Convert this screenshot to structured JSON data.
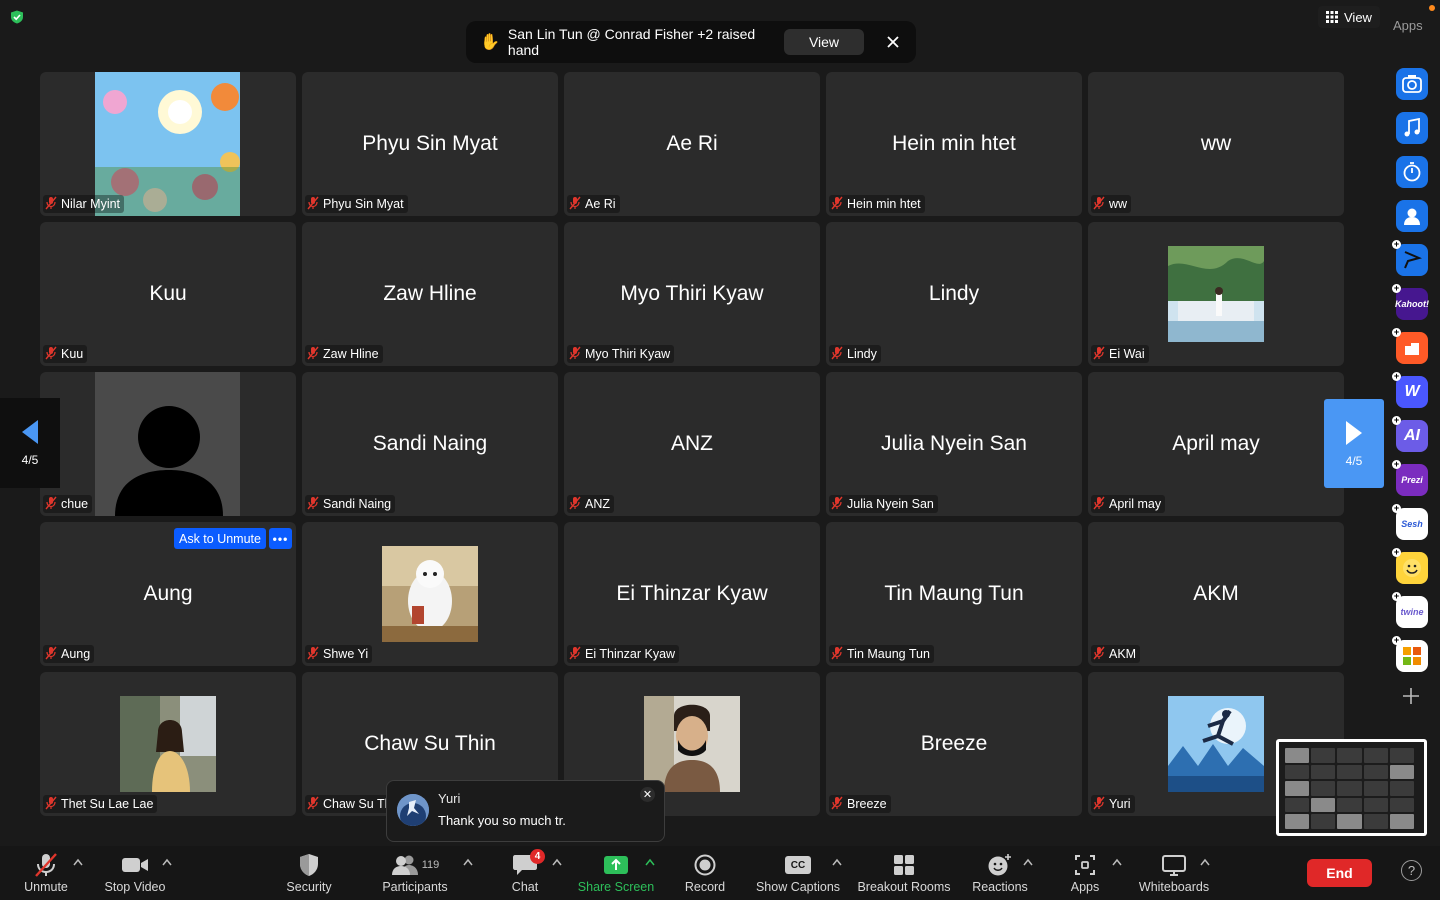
{
  "banner": {
    "text": "San Lin Tun @ Conrad Fisher +2 raised hand",
    "view_label": "View"
  },
  "top_right": {
    "view_label": "View",
    "apps_label": "Apps"
  },
  "pagination": {
    "left_page": "4/5",
    "right_page": "4/5"
  },
  "ask_to_unmute": "Ask to Unmute",
  "participants": [
    {
      "big": "",
      "name": "Nilar Myint",
      "pic": "flowers"
    },
    {
      "big": "Phyu Sin Myat",
      "name": "Phyu Sin Myat"
    },
    {
      "big": "Ae Ri",
      "name": "Ae Ri"
    },
    {
      "big": "Hein min htet",
      "name": "Hein min htet"
    },
    {
      "big": "ww",
      "name": "ww"
    },
    {
      "big": "Kuu",
      "name": "Kuu"
    },
    {
      "big": "Zaw Hline",
      "name": "Zaw Hline"
    },
    {
      "big": "Myo Thiri Kyaw",
      "name": "Myo Thiri Kyaw"
    },
    {
      "big": "Lindy",
      "name": "Lindy"
    },
    {
      "big": "",
      "name": "Ei Wai",
      "pic": "garden"
    },
    {
      "big": "",
      "name": "chue",
      "pic": "silhouette"
    },
    {
      "big": "Sandi Naing",
      "name": "Sandi Naing"
    },
    {
      "big": "ANZ",
      "name": "ANZ"
    },
    {
      "big": "Julia Nyein San",
      "name": "Julia Nyein San"
    },
    {
      "big": "April may",
      "name": "April may"
    },
    {
      "big": "Aung",
      "name": "Aung"
    },
    {
      "big": "",
      "name": "Shwe Yi",
      "pic": "robot"
    },
    {
      "big": "Ei Thinzar Kyaw",
      "name": "Ei Thinzar Kyaw"
    },
    {
      "big": "Tin Maung Tun",
      "name": "Tin Maung Tun"
    },
    {
      "big": "AKM",
      "name": "AKM"
    },
    {
      "big": "",
      "name": "Thet Su Lae Lae",
      "pic": "girl"
    },
    {
      "big": "Chaw Su Thin",
      "name": "Chaw Su Thin"
    },
    {
      "big": "",
      "name": "",
      "pic": "man-mask"
    },
    {
      "big": "Breeze",
      "name": "Breeze"
    },
    {
      "big": "",
      "name": "Yuri",
      "pic": "jumper"
    }
  ],
  "chat_preview": {
    "sender": "Yuri",
    "message": "Thank you so much tr."
  },
  "toolbar": {
    "unmute": "Unmute",
    "stop_video": "Stop Video",
    "security": "Security",
    "participants": "Participants",
    "participant_count": "119",
    "chat": "Chat",
    "chat_badge": "4",
    "share_screen": "Share Screen",
    "record": "Record",
    "show_captions": "Show Captions",
    "captions_icon": "CC",
    "breakout_rooms": "Breakout Rooms",
    "reactions": "Reactions",
    "apps": "Apps",
    "whiteboards": "Whiteboards",
    "end": "End"
  },
  "sidebar_apps": [
    {
      "name": "camera-app-icon",
      "label": ""
    },
    {
      "name": "music-app-icon",
      "label": ""
    },
    {
      "name": "timer-app-icon",
      "label": ""
    },
    {
      "name": "avatar-app-icon",
      "label": ""
    },
    {
      "name": "flag-app-icon",
      "label": ""
    },
    {
      "name": "kahoot-app-icon",
      "label": "Kahoot!"
    },
    {
      "name": "orange-app-icon",
      "label": ""
    },
    {
      "name": "wooclap-app-icon",
      "label": "W"
    },
    {
      "name": "ai-app-icon",
      "label": "AI"
    },
    {
      "name": "prezi-app-icon",
      "label": "Prezi"
    },
    {
      "name": "sesh-app-icon",
      "label": "Sesh"
    },
    {
      "name": "emoji-app-icon",
      "label": ""
    },
    {
      "name": "twine-app-icon",
      "label": "twine"
    },
    {
      "name": "grid-app-icon",
      "label": ""
    }
  ],
  "colors": {
    "background": "#1a1a1a",
    "tile": "#2b2b2b",
    "accent_blue": "#0b5cff",
    "pager_blue": "#4a97f4",
    "end_red": "#e02828",
    "share_green": "#2dbf5a",
    "muted_red": "#e0362c"
  }
}
